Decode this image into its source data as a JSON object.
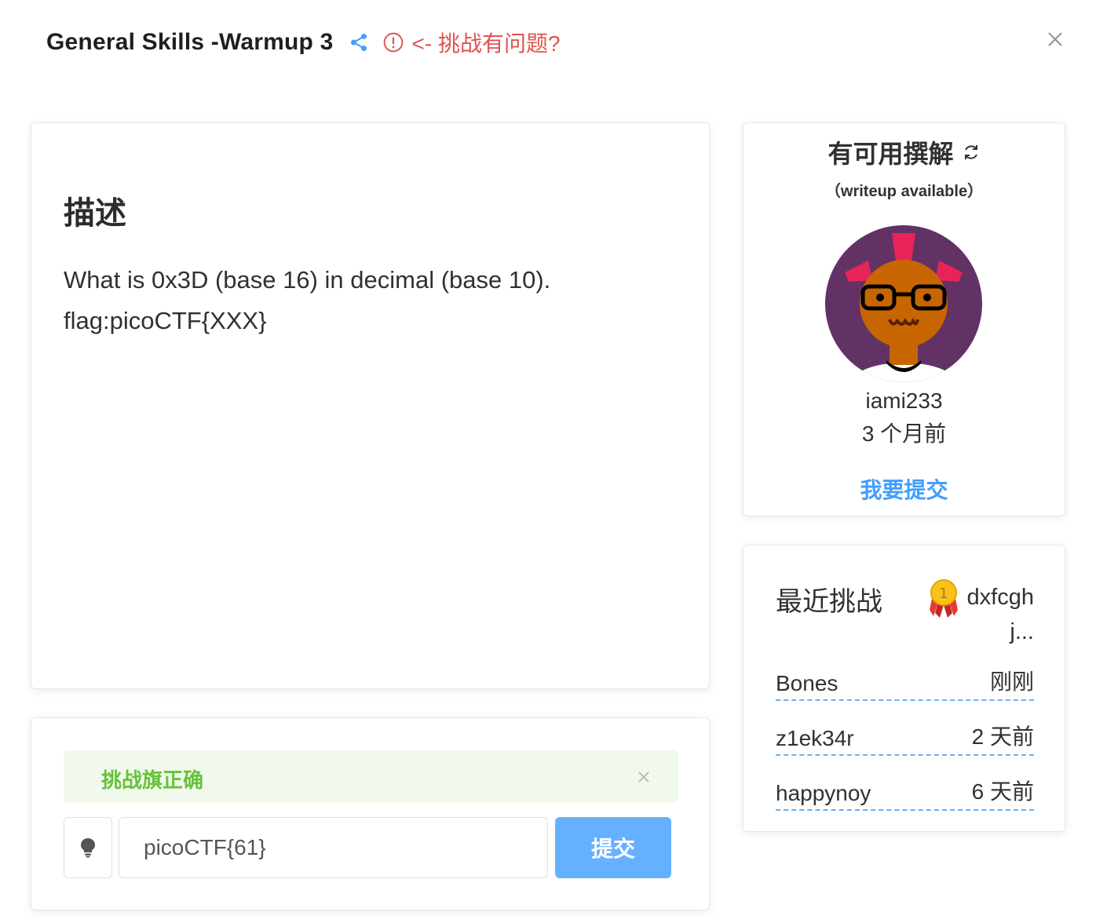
{
  "header": {
    "title": "General Skills -Warmup 3",
    "report_text": "<- 挑战有问题?"
  },
  "colors": {
    "accent_blue": "#409eff",
    "report_red": "#e0534f",
    "success_green": "#67c23a",
    "submit_button": "#66b1ff"
  },
  "description": {
    "heading": "描述",
    "lines": [
      "What is 0x3D (base 16) in decimal (base 10).",
      "flag:picoCTF{XXX}"
    ]
  },
  "submission": {
    "alert_text": "挑战旗正确",
    "flag_value": "picoCTF{61}",
    "submit_label": "提交",
    "hint_icon": "lightbulb-icon"
  },
  "writeup": {
    "title": "有可用撰解",
    "subtitle": "（writeup available）",
    "username": "iami233",
    "time": "3 个月前",
    "submit_link": "我要提交"
  },
  "recent": {
    "title": "最近挑战",
    "first_user": "dxfcgh j...",
    "rows": [
      {
        "user": "Bones",
        "time": "刚刚"
      },
      {
        "user": "z1ek34r",
        "time": "2 天前"
      },
      {
        "user": "happynoy",
        "time": "6 天前"
      }
    ]
  }
}
